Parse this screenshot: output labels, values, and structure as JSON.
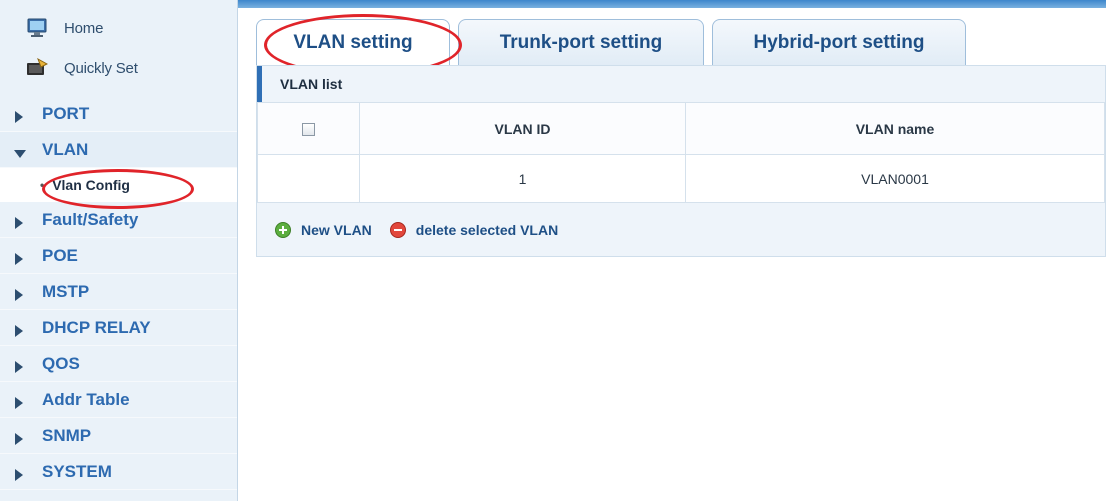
{
  "sidebar": {
    "home_label": "Home",
    "quick_label": "Quickly Set",
    "menu": [
      {
        "label": "PORT",
        "expanded": false
      },
      {
        "label": "VLAN",
        "expanded": true
      },
      {
        "label": "Fault/Safety",
        "expanded": false
      },
      {
        "label": "POE",
        "expanded": false
      },
      {
        "label": "MSTP",
        "expanded": false
      },
      {
        "label": "DHCP RELAY",
        "expanded": false
      },
      {
        "label": "QOS",
        "expanded": false
      },
      {
        "label": "Addr Table",
        "expanded": false
      },
      {
        "label": "SNMP",
        "expanded": false
      },
      {
        "label": "SYSTEM",
        "expanded": false
      }
    ],
    "vlan_sub": {
      "label": "Vlan Config"
    }
  },
  "tabs": [
    {
      "label": "VLAN setting",
      "active": true
    },
    {
      "label": "Trunk-port setting",
      "active": false
    },
    {
      "label": "Hybrid-port setting",
      "active": false
    }
  ],
  "vlan_list": {
    "title": "VLAN list",
    "columns": [
      "",
      "VLAN ID",
      "VLAN name"
    ],
    "rows": [
      {
        "vlan_id": "1",
        "vlan_name": "VLAN0001"
      }
    ]
  },
  "actions": {
    "new_label": "New VLAN",
    "delete_label": "delete selected VLAN"
  },
  "colors": {
    "accent": "#2d6ab0",
    "annotation": "#e0242a",
    "sidebar_bg": "#eaf2f9"
  },
  "icons": {
    "home": "home-icon",
    "quick": "quick-set-icon",
    "new": "add-circle-icon",
    "delete": "remove-circle-icon"
  }
}
